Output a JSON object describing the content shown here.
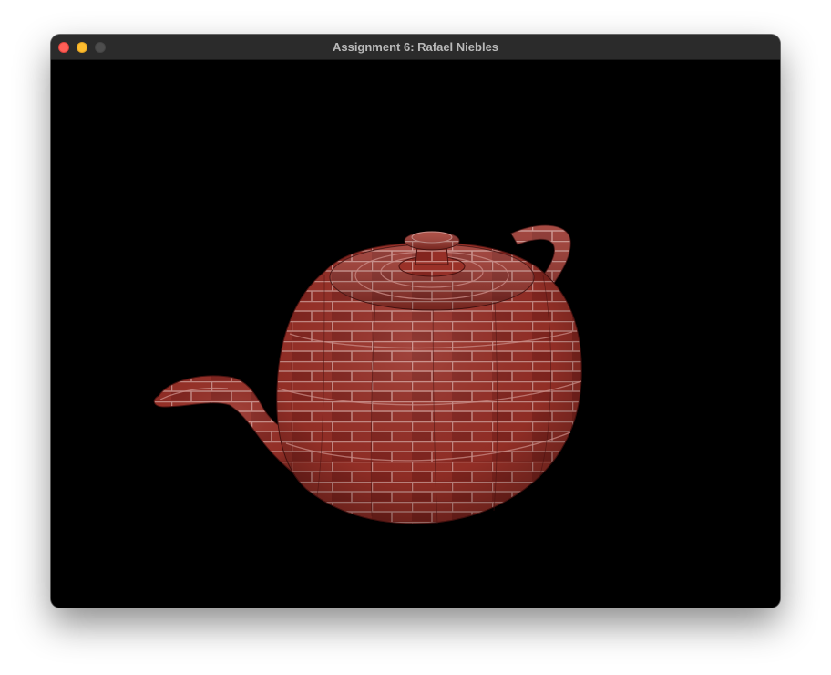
{
  "window": {
    "title": "Assignment 6: Rafael Niebles",
    "controls": {
      "close_icon": "close-icon",
      "minimize_icon": "minimize-icon",
      "zoom_icon": "zoom-icon"
    }
  },
  "viewport": {
    "background_color": "#000000",
    "object": "brick-textured-teapot",
    "object_colors": {
      "brick": "#8e2b24",
      "mortar": "#c98a84",
      "shadow": "#4a1210"
    }
  }
}
